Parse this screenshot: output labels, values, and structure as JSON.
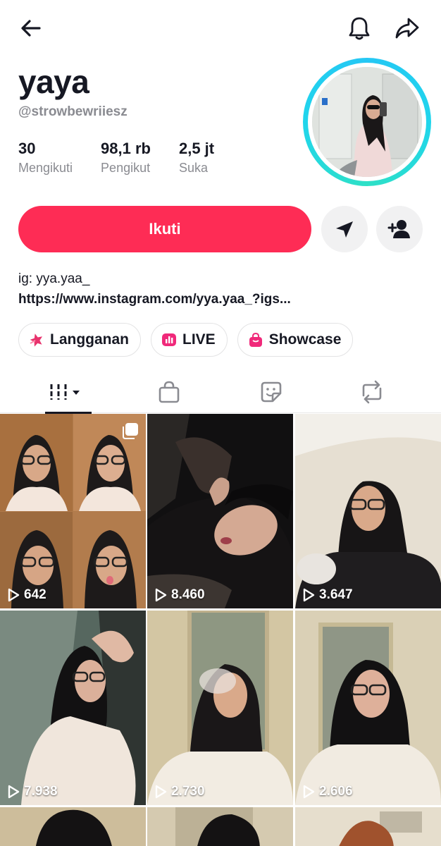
{
  "header": {
    "back_icon": "arrow-left-icon",
    "bell_icon": "bell-icon",
    "share_icon": "share-arrow-icon"
  },
  "profile": {
    "display_name": "yaya",
    "username": "@strowbewriiesz",
    "stats": [
      {
        "value": "30",
        "label": "Mengikuti"
      },
      {
        "value": "98,1 rb",
        "label": "Pengikut"
      },
      {
        "value": "2,5 jt",
        "label": "Suka"
      }
    ],
    "ring_color": "#20d5ec"
  },
  "actions": {
    "follow_label": "Ikuti",
    "follow_color": "#fe2c55",
    "message_icon": "send-message-icon",
    "add_friend_icon": "add-friend-icon"
  },
  "bio": {
    "line1": "ig: yya.yaa_",
    "link": "https://www.instagram.com/yya.yaa_?igs..."
  },
  "chips": [
    {
      "label": "Langganan",
      "icon": "subscription-star-icon"
    },
    {
      "label": "LIVE",
      "icon": "live-icon"
    },
    {
      "label": "Showcase",
      "icon": "shopping-bag-icon"
    }
  ],
  "tabs": [
    {
      "name": "videos",
      "icon": "grid-bars-icon",
      "active": true
    },
    {
      "name": "shop",
      "icon": "shopping-bag-icon"
    },
    {
      "name": "sticker",
      "icon": "sticker-icon"
    },
    {
      "name": "repost",
      "icon": "repost-icon"
    }
  ],
  "videos": [
    {
      "views": "642",
      "multi": true
    },
    {
      "views": "8.460"
    },
    {
      "views": "3.647"
    },
    {
      "views": "7.938"
    },
    {
      "views": "2.730"
    },
    {
      "views": "2.606"
    }
  ]
}
